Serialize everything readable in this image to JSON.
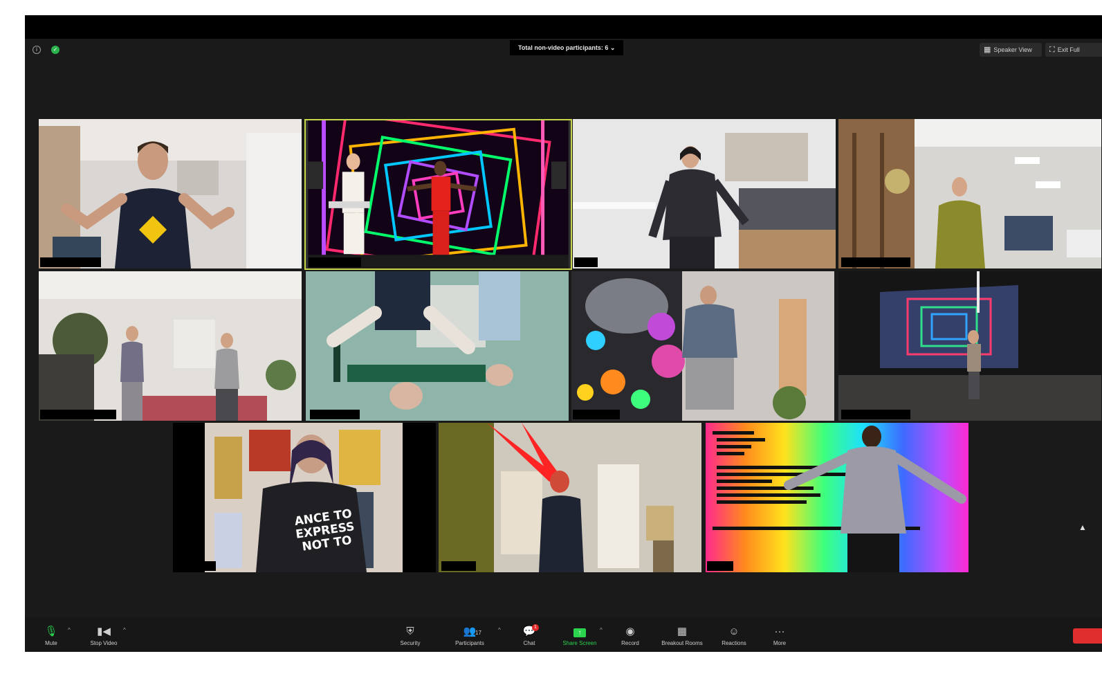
{
  "top_bar": {
    "participants_banner": "Total non-video participants: 6",
    "speaker_view_label": "Speaker View",
    "exit_fullscreen_label": "Exit Full"
  },
  "icons": {
    "info": "info-icon",
    "security_status": "shield-icon",
    "mouse_cursor": "cursor-icon"
  },
  "tiles": [
    {
      "scene": "man-in-tank-top-dancing",
      "active_speaker": false
    },
    {
      "scene": "neon-tunnel-performers",
      "active_speaker": true
    },
    {
      "scene": "woman-dancing-bedroom",
      "active_speaker": false
    },
    {
      "scene": "woman-dancing-studio",
      "active_speaker": false
    },
    {
      "scene": "two-women-dancing-living-room",
      "active_speaker": false
    },
    {
      "scene": "upside-down-view",
      "active_speaker": false
    },
    {
      "scene": "dancer-with-colorful-bubbles",
      "active_speaker": false
    },
    {
      "scene": "dark-stage-projection",
      "active_speaker": false
    },
    {
      "scene": "woman-with-slogan-shirt",
      "active_speaker": false
    },
    {
      "scene": "woman-with-red-beams",
      "active_speaker": false
    },
    {
      "scene": "rainbow-code-background",
      "active_speaker": false
    }
  ],
  "tile_texts": {
    "shirt_text": [
      "ANCE TO",
      "EXPRESS",
      "NOT TO"
    ]
  },
  "toolbar": {
    "mute": "Mute",
    "stop_video": "Stop Video",
    "security": "Security",
    "participants": "Participants",
    "participants_count": "17",
    "chat": "Chat",
    "chat_badge": "1",
    "share_screen": "Share Screen",
    "record": "Record",
    "breakout_rooms": "Breakout Rooms",
    "reactions": "Reactions",
    "more": "More"
  },
  "colors": {
    "app_background": "#1a1a1a",
    "active_speaker_border": "#c8d84a",
    "share_screen_green": "#2bd34f",
    "end_red": "#e02d2d"
  }
}
